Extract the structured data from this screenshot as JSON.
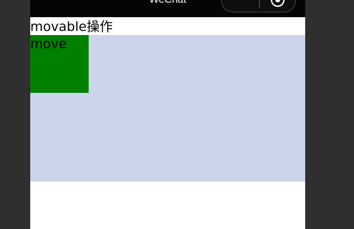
{
  "navbar": {
    "title": "WeChat",
    "capsule": {
      "more_label": "•••",
      "more_icon": "more-dots-icon",
      "close_icon": "target-close-icon"
    },
    "background": "#050505"
  },
  "page": {
    "label": "movable操作",
    "movable_area": {
      "background": "#ccd4ea",
      "view": {
        "label": "move",
        "background": "#008000"
      }
    }
  }
}
